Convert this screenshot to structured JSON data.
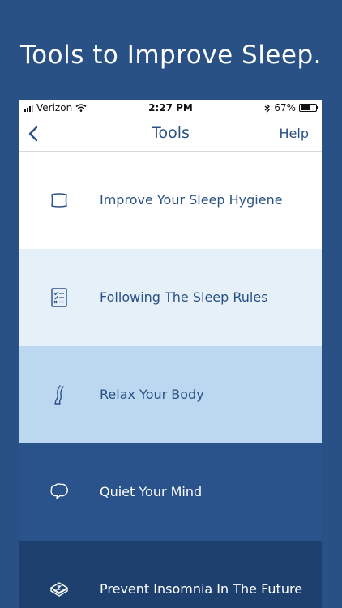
{
  "headline": "Tools to Improve Sleep.",
  "status_bar": {
    "carrier": "Verizon",
    "time": "2:27 PM",
    "battery_percent": "67%",
    "battery_level": 0.67
  },
  "nav": {
    "title": "Tools",
    "help_label": "Help"
  },
  "tools": [
    {
      "label": "Improve Your Sleep Hygiene",
      "icon": "pillow-icon",
      "bg": "#ffffff",
      "fg": "#2a5185"
    },
    {
      "label": "Following The Sleep Rules",
      "icon": "checklist-icon",
      "bg": "#e6f0f9",
      "fg": "#2a5185"
    },
    {
      "label": "Relax Your Body",
      "icon": "leg-icon",
      "bg": "#bcd8f0",
      "fg": "#2a5185"
    },
    {
      "label": "Quiet Your Mind",
      "icon": "thought-bubble-icon",
      "bg": "#29538a",
      "fg": "#ffffff"
    },
    {
      "label": "Prevent Insomnia In The Future",
      "icon": "sleeping-book-icon",
      "bg": "#1e406f",
      "fg": "#ffffff"
    }
  ],
  "colors": {
    "background": "#2a5185",
    "accent": "#2a5185"
  }
}
